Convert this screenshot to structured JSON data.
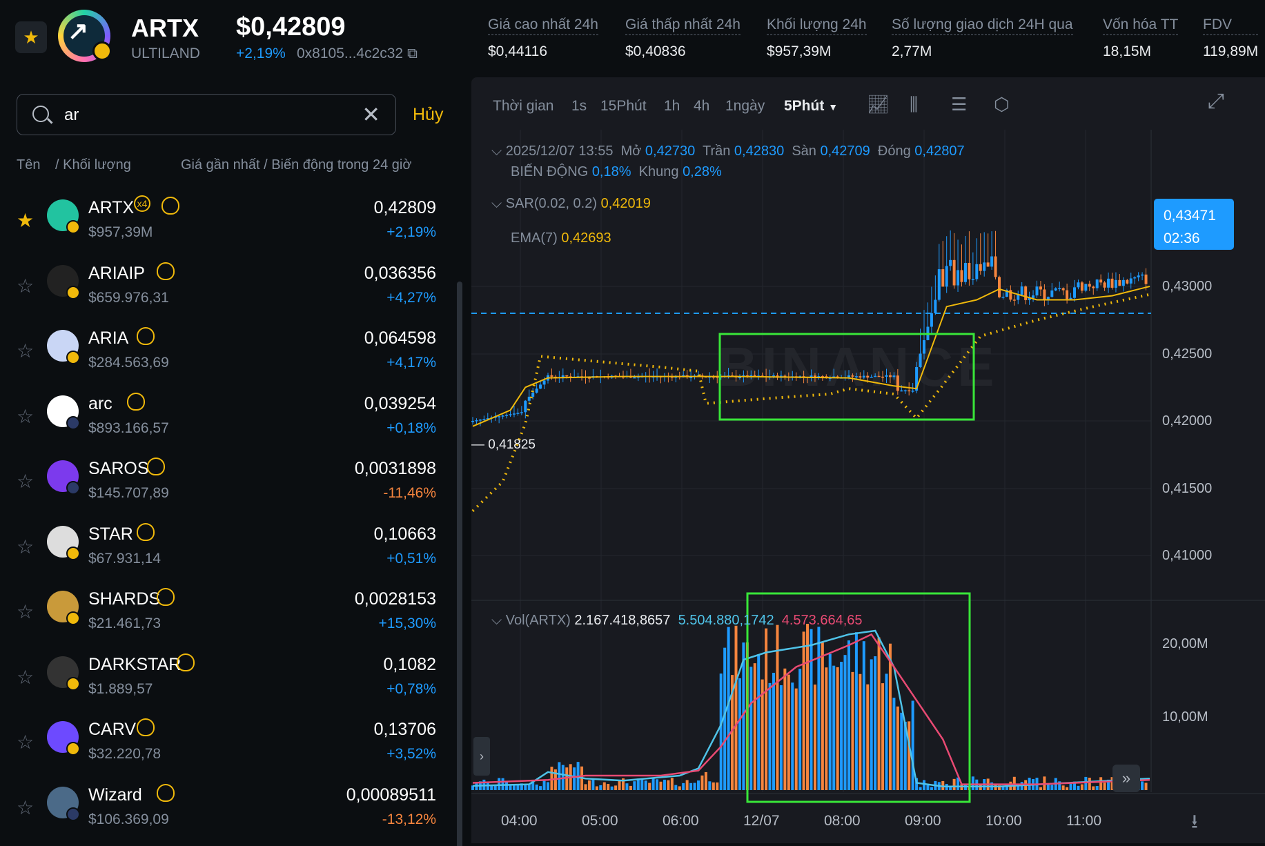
{
  "header": {
    "symbol": "ARTX",
    "project": "ULTILAND",
    "price": "$0,42809",
    "change": "+2,19%",
    "address": "0x8105...4c2c32",
    "stats": [
      {
        "label": "Giá cao nhất 24h",
        "value": "$0,44116"
      },
      {
        "label": "Giá thấp nhất 24h",
        "value": "$0,40836"
      },
      {
        "label": "Khối lượng 24h",
        "value": "$957,39M"
      },
      {
        "label": "Số lượng giao dịch 24H qua",
        "value": "2,77M"
      },
      {
        "label": "Vốn hóa TT",
        "value": "18,15M"
      },
      {
        "label": "FDV",
        "value": "119,89M"
      }
    ]
  },
  "search": {
    "query": "ar",
    "cancel": "Hủy",
    "col_name": "Tên",
    "col_volume": "/ Khối lượng",
    "col_price": "Giá gần nhất / Biến động trong 24 giờ"
  },
  "tokens": [
    {
      "name": "ARTX",
      "volume": "$957,39M",
      "price": "0,42809",
      "change": "+2,19%",
      "dir": "up",
      "fav": true,
      "extra": "x4"
    },
    {
      "name": "ARIAIP",
      "volume": "$659.976,31",
      "price": "0,036356",
      "change": "+4,27%",
      "dir": "up"
    },
    {
      "name": "ARIA",
      "volume": "$284.563,69",
      "price": "0,064598",
      "change": "+4,17%",
      "dir": "up"
    },
    {
      "name": "arc",
      "volume": "$893.166,57",
      "price": "0,039254",
      "change": "+0,18%",
      "dir": "up"
    },
    {
      "name": "SAROS",
      "volume": "$145.707,89",
      "price": "0,0031898",
      "change": "-11,46%",
      "dir": "down"
    },
    {
      "name": "STAR",
      "volume": "$67.931,14",
      "price": "0,10663",
      "change": "+0,51%",
      "dir": "up"
    },
    {
      "name": "SHARDS",
      "volume": "$21.461,73",
      "price": "0,0028153",
      "change": "+15,30%",
      "dir": "up"
    },
    {
      "name": "DARKSTAR",
      "volume": "$1.889,57",
      "price": "0,1082",
      "change": "+0,78%",
      "dir": "up"
    },
    {
      "name": "CARV",
      "volume": "$32.220,78",
      "price": "0,13706",
      "change": "+3,52%",
      "dir": "up"
    },
    {
      "name": "Wizard",
      "volume": "$106.369,09",
      "price": "0,00089511",
      "change": "-13,12%",
      "dir": "down"
    }
  ],
  "toolbar": {
    "time": "Thời gian",
    "intervals": [
      "1s",
      "15Phút",
      "1h",
      "4h",
      "1ngày"
    ],
    "active_interval": "5Phút"
  },
  "candle_info": {
    "datetime": "2025/12/07 13:55",
    "open_label": "Mở",
    "open": "0,42730",
    "high_label": "Trần",
    "high": "0,42830",
    "low_label": "Sàn",
    "low": "0,42709",
    "close_label": "Đóng",
    "close": "0,42807",
    "change_label": "BIẾN ĐỘNG",
    "change": "0,18%",
    "range_label": "Khung",
    "range": "0,28%",
    "sar_label": "SAR(0.02, 0.2)",
    "sar": "0,42019",
    "ema_label": "EMA(7)",
    "ema": "0,42693",
    "vol_label": "Vol(ARTX)",
    "vol": "2.167.418,8657",
    "vol_ma1": "5.504.880,1742",
    "vol_ma2": "4.573.664,65"
  },
  "price_tag": {
    "price": "0,43471",
    "countdown": "02:36"
  },
  "low_marker": "0,41825",
  "watermark": "BINANCE",
  "chart_data": {
    "type": "candlestick",
    "interval": "5Phút",
    "y_ticks": [
      "0,43000",
      "0,42500",
      "0,42000",
      "0,41500",
      "0,41000"
    ],
    "vol_ticks": [
      "20,00M",
      "10,00M"
    ],
    "x_ticks": [
      "04:00",
      "05:00",
      "06:00",
      "12/07",
      "08:00",
      "09:00",
      "10:00",
      "11:00"
    ],
    "ylim": [
      0.408,
      0.436
    ],
    "current_price": 0.43471,
    "ema_points": [
      [
        0,
        0.4196
      ],
      [
        10,
        0.4208
      ],
      [
        14,
        0.4225
      ],
      [
        20,
        0.4232
      ],
      [
        40,
        0.4233
      ],
      [
        70,
        0.4233
      ],
      [
        100,
        0.4232
      ],
      [
        112,
        0.4226
      ],
      [
        118,
        0.4224
      ],
      [
        126,
        0.4285
      ],
      [
        134,
        0.429
      ],
      [
        140,
        0.4298
      ],
      [
        150,
        0.429
      ],
      [
        160,
        0.429
      ],
      [
        170,
        0.4293
      ],
      [
        180,
        0.43
      ]
    ],
    "sar_points": [
      [
        0,
        0.4133
      ],
      [
        8,
        0.4155
      ],
      [
        14,
        0.4198
      ],
      [
        18,
        0.4248
      ],
      [
        30,
        0.4245
      ],
      [
        50,
        0.424
      ],
      [
        60,
        0.4237
      ],
      [
        62,
        0.4213
      ],
      [
        80,
        0.4217
      ],
      [
        95,
        0.422
      ],
      [
        100,
        0.4224
      ],
      [
        112,
        0.422
      ],
      [
        118,
        0.4202
      ],
      [
        124,
        0.4223
      ],
      [
        135,
        0.4263
      ],
      [
        150,
        0.4275
      ],
      [
        165,
        0.4285
      ],
      [
        180,
        0.4294
      ]
    ],
    "volume_ma1": [
      [
        0,
        0.6
      ],
      [
        15,
        0.8
      ],
      [
        20,
        2.5
      ],
      [
        30,
        1.6
      ],
      [
        40,
        1.3
      ],
      [
        55,
        2.0
      ],
      [
        60,
        3.0
      ],
      [
        66,
        9.0
      ],
      [
        72,
        18.0
      ],
      [
        78,
        19.0
      ],
      [
        90,
        20.0
      ],
      [
        100,
        21.5
      ],
      [
        107,
        22.0
      ],
      [
        112,
        17.0
      ],
      [
        118,
        1.0
      ],
      [
        125,
        0.5
      ],
      [
        140,
        0.5
      ],
      [
        180,
        1.6
      ]
    ],
    "volume_ma2": [
      [
        0,
        1.0
      ],
      [
        20,
        1.4
      ],
      [
        30,
        2.0
      ],
      [
        50,
        2.0
      ],
      [
        60,
        2.7
      ],
      [
        66,
        6.0
      ],
      [
        74,
        12.0
      ],
      [
        86,
        17.0
      ],
      [
        100,
        20.0
      ],
      [
        106,
        21.5
      ],
      [
        112,
        17.0
      ],
      [
        125,
        7.0
      ],
      [
        130,
        0.8
      ],
      [
        150,
        0.8
      ],
      [
        180,
        1.4
      ]
    ],
    "highlight_boxes": [
      "consolidation",
      "volume-spike"
    ]
  }
}
